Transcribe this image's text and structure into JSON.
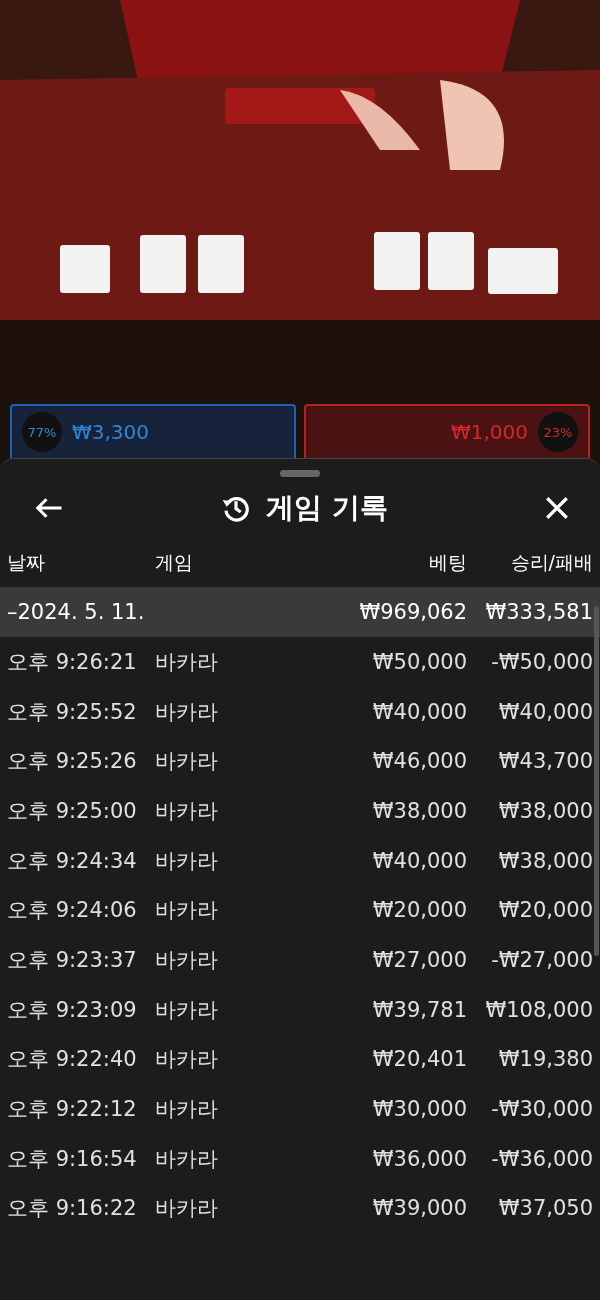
{
  "bet_bar": {
    "player": {
      "percent": "77%",
      "amount": "₩3,300"
    },
    "banker": {
      "percent": "23%",
      "amount": "₩1,000"
    }
  },
  "sheet": {
    "title": "게임 기록",
    "columns": [
      "날짜",
      "게임",
      "베팅",
      "승리/패배"
    ],
    "group": {
      "date": "–2024. 5. 11.",
      "bet": "₩969,062",
      "result": "₩333,581",
      "expanded": true
    },
    "rows": [
      {
        "time": "오후 9:26:21",
        "game": "바카라",
        "bet": "₩50,000",
        "result": "-₩50,000"
      },
      {
        "time": "오후 9:25:52",
        "game": "바카라",
        "bet": "₩40,000",
        "result": "₩40,000"
      },
      {
        "time": "오후 9:25:26",
        "game": "바카라",
        "bet": "₩46,000",
        "result": "₩43,700"
      },
      {
        "time": "오후 9:25:00",
        "game": "바카라",
        "bet": "₩38,000",
        "result": "₩38,000"
      },
      {
        "time": "오후 9:24:34",
        "game": "바카라",
        "bet": "₩40,000",
        "result": "₩38,000"
      },
      {
        "time": "오후 9:24:06",
        "game": "바카라",
        "bet": "₩20,000",
        "result": "₩20,000"
      },
      {
        "time": "오후 9:23:37",
        "game": "바카라",
        "bet": "₩27,000",
        "result": "-₩27,000"
      },
      {
        "time": "오후 9:23:09",
        "game": "바카라",
        "bet": "₩39,781",
        "result": "₩108,000"
      },
      {
        "time": "오후 9:22:40",
        "game": "바카라",
        "bet": "₩20,401",
        "result": "₩19,380"
      },
      {
        "time": "오후 9:22:12",
        "game": "바카라",
        "bet": "₩30,000",
        "result": "-₩30,000"
      },
      {
        "time": "오후 9:16:54",
        "game": "바카라",
        "bet": "₩36,000",
        "result": "-₩36,000"
      },
      {
        "time": "오후 9:16:22",
        "game": "바카라",
        "bet": "₩39,000",
        "result": "₩37,050"
      }
    ]
  }
}
